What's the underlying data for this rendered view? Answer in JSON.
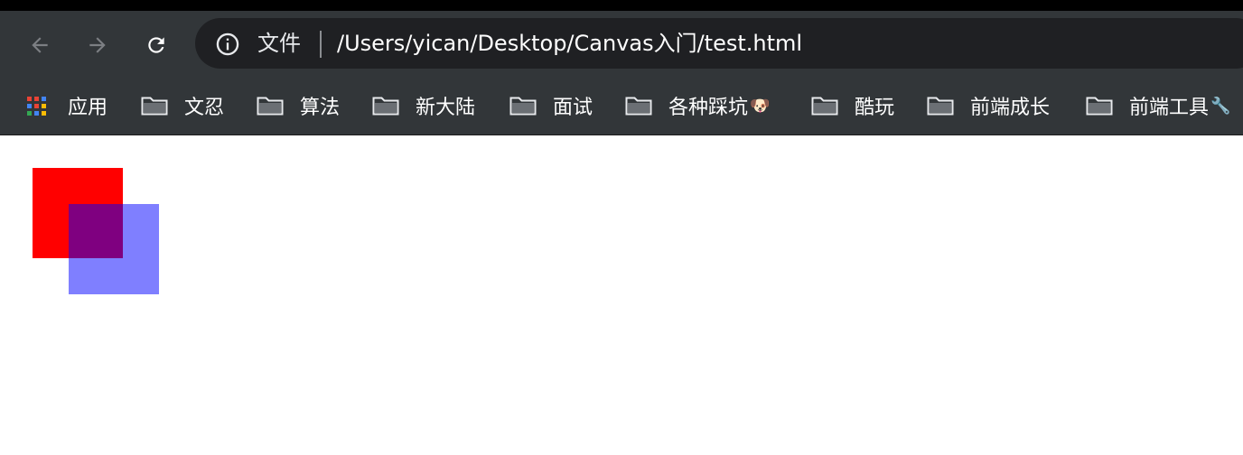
{
  "toolbar": {
    "back_icon": "arrow-left-icon",
    "forward_icon": "arrow-right-icon",
    "reload_icon": "reload-icon",
    "info_icon": "info-icon"
  },
  "omnibox": {
    "scheme_label": "文件",
    "url": "/Users/yican/Desktop/Canvas入门/test.html"
  },
  "bookmarks": {
    "apps_label": "应用",
    "items": [
      {
        "label": "文忍",
        "emoji": ""
      },
      {
        "label": "算法",
        "emoji": ""
      },
      {
        "label": "新大陆",
        "emoji": ""
      },
      {
        "label": "面试",
        "emoji": ""
      },
      {
        "label": "各种踩坑",
        "emoji": "🐶"
      },
      {
        "label": "酷玩",
        "emoji": ""
      },
      {
        "label": "前端成长",
        "emoji": ""
      },
      {
        "label": "前端工具",
        "emoji": "🔧"
      }
    ]
  },
  "canvas": {
    "rect1_color": "#ff0000",
    "rect2_color": "rgba(0,0,255,0.5)"
  },
  "colors": {
    "chrome_bg": "#323639",
    "omnibox_bg": "#1f2023",
    "page_bg": "#ffffff"
  }
}
